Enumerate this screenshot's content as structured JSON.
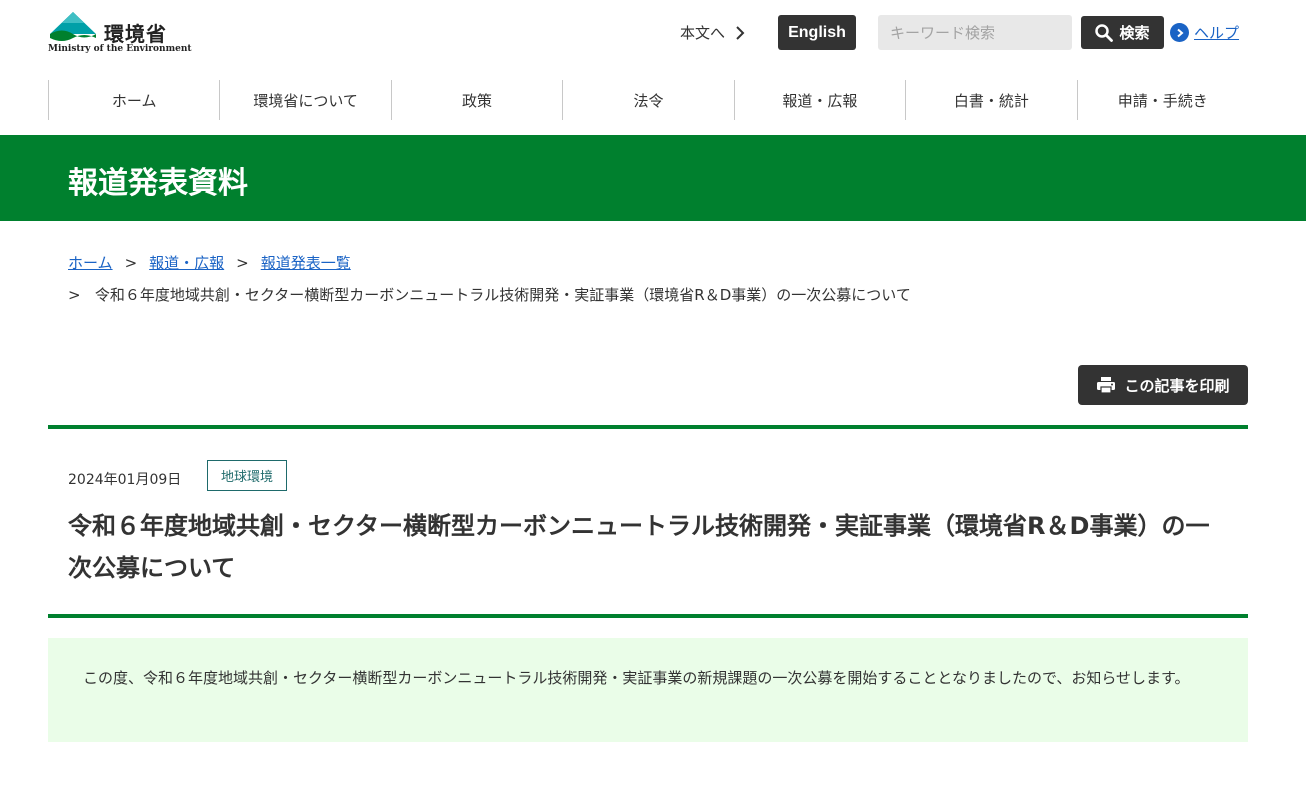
{
  "header": {
    "logo_text": "環境省",
    "logo_sub": "Ministry of the Environment",
    "skip_link": "本文へ",
    "english_label": "English",
    "search_placeholder": "キーワード検索",
    "search_button": "検索",
    "help_label": "ヘルプ"
  },
  "nav": {
    "items": [
      "ホーム",
      "環境省について",
      "政策",
      "法令",
      "報道・広報",
      "白書・統計",
      "申請・手続き"
    ]
  },
  "banner": {
    "title": "報道発表資料"
  },
  "breadcrumb": {
    "home": "ホーム",
    "press": "報道・広報",
    "list": "報道発表一覧",
    "separator": ">",
    "current": "令和６年度地域共創・セクター横断型カーボンニュートラル技術開発・実証事業（環境省R＆D事業）の一次公募について"
  },
  "print_button": "この記事を印刷",
  "article": {
    "date": "2024年01月09日",
    "tag": "地球環境",
    "title": "令和６年度地域共創・セクター横断型カーボンニュートラル技術開発・実証事業（環境省R＆D事業）の一次公募について",
    "summary": "この度、令和６年度地域共創・セクター横断型カーボンニュートラル技術開発・実証事業の新規課題の一次公募を開始することとなりましたので、お知らせします。"
  },
  "colors": {
    "brand_green": "#00802e",
    "dark_button": "#333333",
    "link_blue": "#1a63c5",
    "summary_bg": "#eafde8",
    "tag_teal": "#1e6a6b"
  },
  "icons": [
    "ministry-logo-icon",
    "chevron-right-icon",
    "search-icon",
    "help-chevron-icon",
    "printer-icon"
  ]
}
